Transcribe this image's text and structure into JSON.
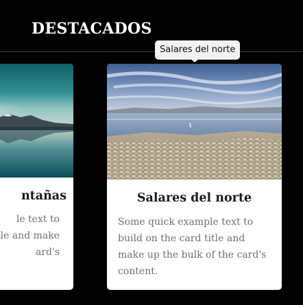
{
  "section": {
    "title": "DESTACADOS"
  },
  "tooltip": {
    "text": "Salares del norte"
  },
  "cards": [
    {
      "title": "ntañas",
      "text_lines": [
        "le text to",
        "itle and make",
        "ard's"
      ]
    },
    {
      "title": "Salares del norte",
      "text": "Some quick example text to build on the card title and make up the bulk of the card's content."
    }
  ],
  "colors": {
    "background": "#000000",
    "card_background": "#ffffff",
    "title": "#1b1b1b",
    "body_text": "#6f6f6f",
    "tooltip_background": "#f2f2f2"
  }
}
